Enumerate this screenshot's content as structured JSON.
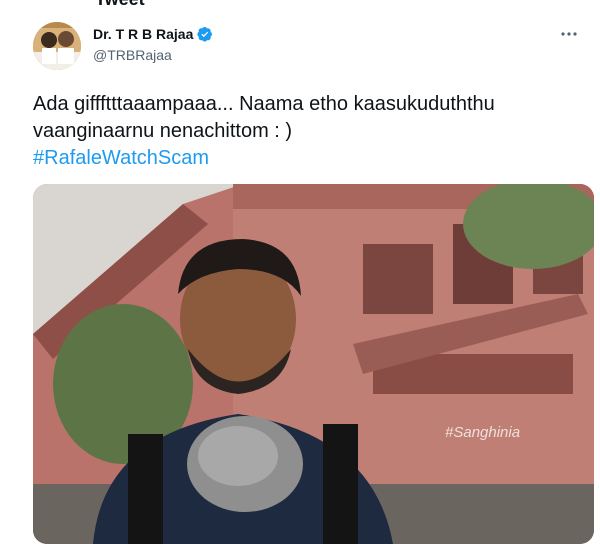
{
  "header": {
    "title_fragment": "Tweet"
  },
  "author": {
    "display_name": "Dr. T R B Rajaa",
    "handle": "@TRBRajaa",
    "verified": true
  },
  "tweet": {
    "line1": "Ada giffftttaaampaaa... Naama etho kaasukuduththu",
    "line2": "vaanginaarnu nenachittom : )",
    "hashtag": "#RafaleWatchScam"
  },
  "media": {
    "watermark": "#Sanghinia"
  },
  "colors": {
    "accent": "#1d9bf0",
    "text": "#0f1419",
    "secondary": "#536471"
  },
  "icons": {
    "more": "more-icon",
    "verified": "verified-badge-icon"
  }
}
